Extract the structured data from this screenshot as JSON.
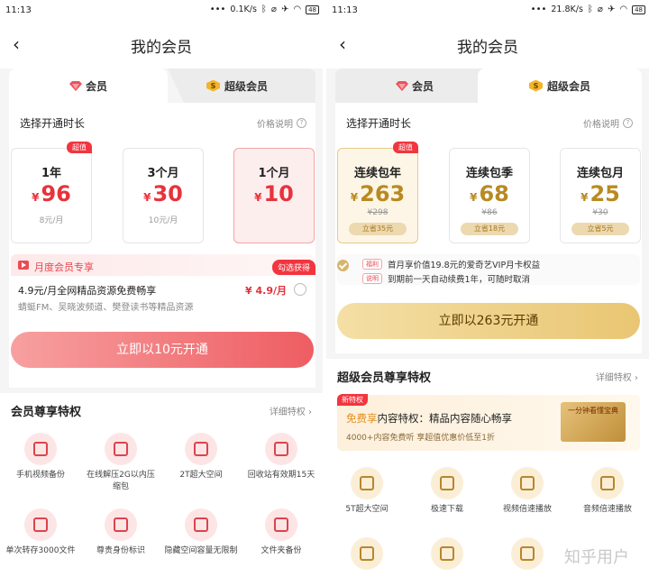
{
  "left": {
    "status": {
      "time": "11:13",
      "speed": "0.1K/s",
      "battery": "48"
    },
    "header": {
      "title": "我的会员"
    },
    "tabs": [
      {
        "label": "会员"
      },
      {
        "label": "超级会员"
      }
    ],
    "section": {
      "title": "选择开通时长",
      "help": "价格说明"
    },
    "plans": [
      {
        "name": "1年",
        "currency": "¥",
        "price": "96",
        "sub": "8元/月",
        "tag": "超值"
      },
      {
        "name": "3个月",
        "currency": "¥",
        "price": "30",
        "sub": "10元/月"
      },
      {
        "name": "1个月",
        "currency": "¥",
        "price": "10"
      }
    ],
    "promo": {
      "title": "月度会员专享",
      "line1": "4.9元/月全网精品资源免费畅享",
      "line2": "蜻蜓FM、吴晓波频道、樊登读书等精品资源",
      "price": "¥ 4.9/月",
      "tag": "勾选获得"
    },
    "cta": {
      "label": "立即以10元开通"
    },
    "benefits": {
      "title": "会员尊享特权",
      "more": "详细特权 ›",
      "items": [
        {
          "label": "手机视频备份",
          "icon": "video-backup-icon"
        },
        {
          "label": "在线解压2G以内压缩包",
          "icon": "unzip-cloud-icon"
        },
        {
          "label": "2T超大空间",
          "icon": "storage-icon"
        },
        {
          "label": "回收站有效期15天",
          "icon": "recycle-bin-icon"
        },
        {
          "label": "单次转存3000文件",
          "icon": "transfer-icon"
        },
        {
          "label": "尊贵身份标识",
          "icon": "vip-badge-icon"
        },
        {
          "label": "隐藏空间容量无限制",
          "icon": "hidden-space-icon"
        },
        {
          "label": "文件夹备份",
          "icon": "folder-backup-icon"
        }
      ]
    }
  },
  "right": {
    "status": {
      "time": "11:13",
      "speed": "21.8K/s",
      "battery": "48"
    },
    "header": {
      "title": "我的会员"
    },
    "tabs": [
      {
        "label": "会员"
      },
      {
        "label": "超级会员"
      }
    ],
    "section": {
      "title": "选择开通时长",
      "help": "价格说明"
    },
    "plans": [
      {
        "name": "连续包年",
        "currency": "¥",
        "price": "263",
        "old": "¥298",
        "save": "立省35元",
        "tag": "超值"
      },
      {
        "name": "连续包季",
        "currency": "¥",
        "price": "68",
        "old": "¥86",
        "save": "立省18元"
      },
      {
        "name": "连续包月",
        "currency": "¥",
        "price": "25",
        "old": "¥30",
        "save": "立省5元"
      }
    ],
    "perks": [
      {
        "tag": "福利",
        "text": "首月享价值19.8元的爱奇艺VIP月卡权益"
      },
      {
        "tag": "说明",
        "text": "到期前一天自动续费1年，可随时取消"
      }
    ],
    "cta": {
      "label": "立即以263元开通"
    },
    "benefits": {
      "title": "超级会员尊享特权",
      "more": "详细特权 ›",
      "new_card": {
        "tag": "新特权",
        "title_hl": "免费享",
        "title_rest": "内容特权：精品内容随心畅享",
        "sub": "4000+内容免费听  享超值优惠价低至1折",
        "cover": "一分钟看懂宝典"
      },
      "items": [
        {
          "label": "5T超大空间",
          "icon": "storage-icon"
        },
        {
          "label": "极速下载",
          "icon": "fast-download-icon"
        },
        {
          "label": "视频倍速播放",
          "icon": "video-speed-icon"
        },
        {
          "label": "音频倍速播放",
          "icon": "audio-speed-icon"
        },
        {
          "label": "",
          "icon": "fast-forward-icon"
        },
        {
          "label": "",
          "icon": "transfer-icon"
        },
        {
          "label": "",
          "icon": "cloud-icon"
        }
      ]
    },
    "watermark": "知乎用户"
  },
  "colors": {
    "red": "#e8323c",
    "gold": "#b98a22",
    "gold_button": "#e9c673",
    "pink_button": "#ee5d62"
  }
}
